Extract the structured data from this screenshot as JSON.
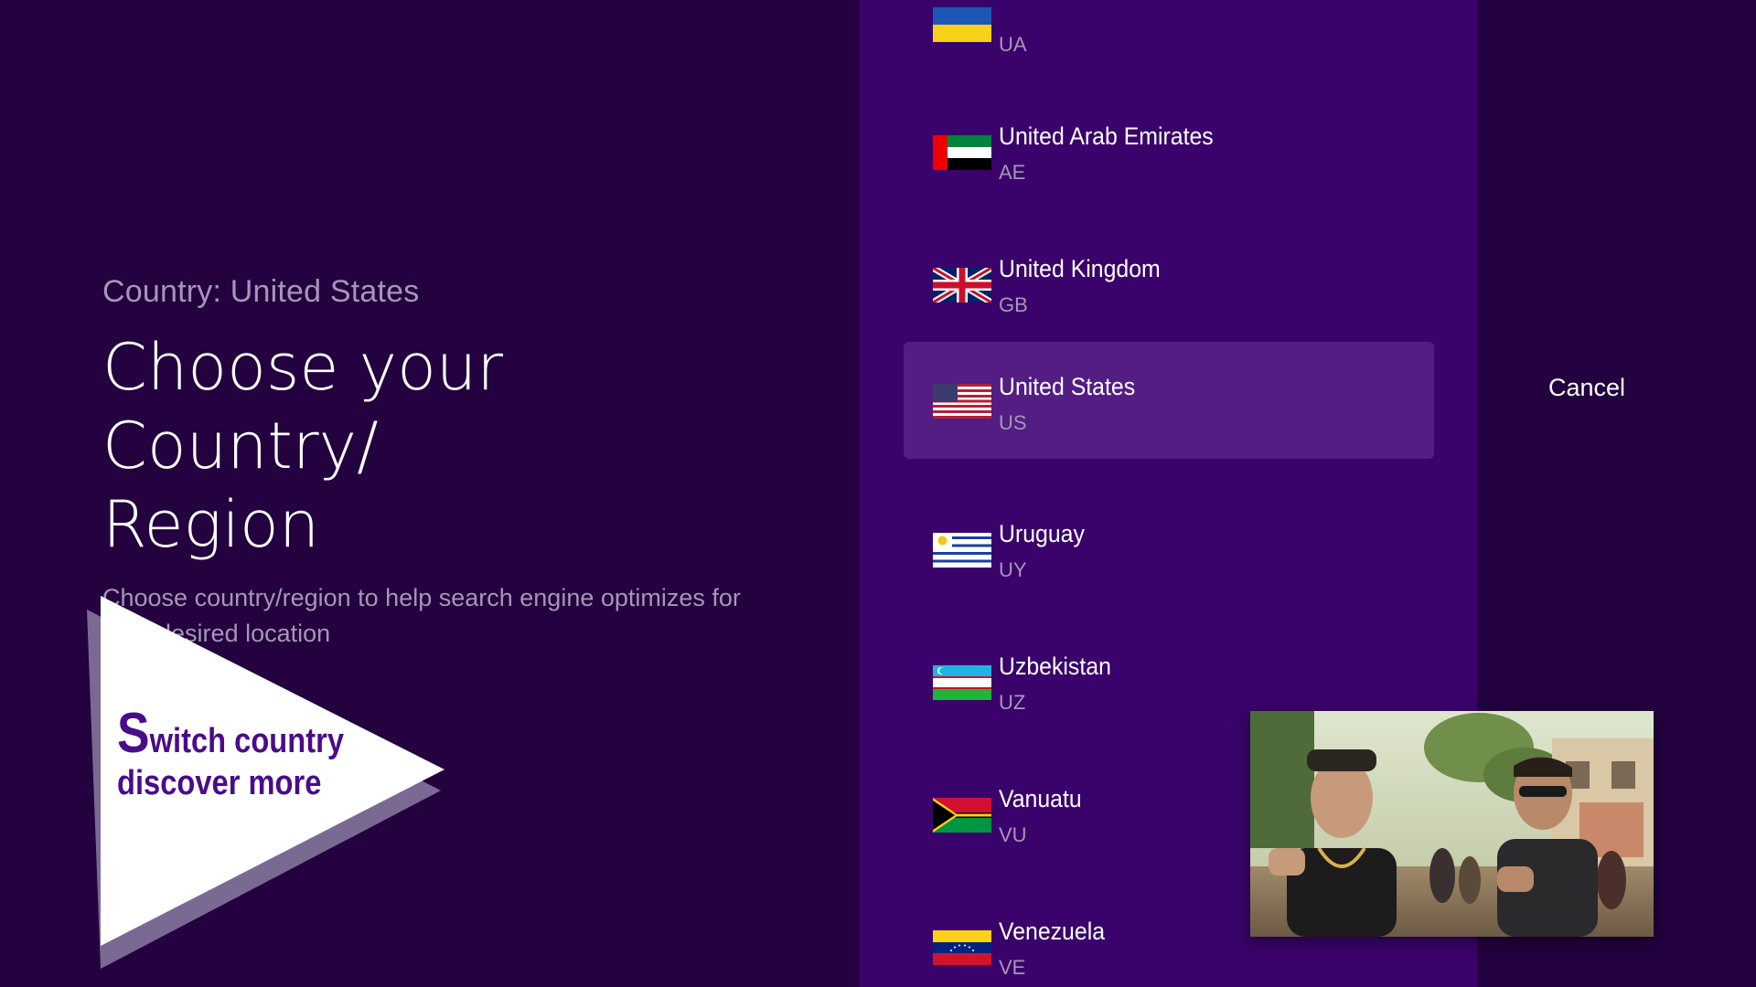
{
  "info": {
    "current_country": "Country: United States",
    "title_line1": "Choose your Country/",
    "title_line2": "Region",
    "subtitle": "Choose country/region to help search engine optimizes for your desired location"
  },
  "promo": {
    "line1_cap": "S",
    "line1_rest": "witch country",
    "line2": "discover more",
    "icon": "play-triangle-icon"
  },
  "countries": [
    {
      "name": "",
      "code": "UA",
      "flag": "flag-ua-icon",
      "selected": false
    },
    {
      "name": "United Arab Emirates",
      "code": "AE",
      "flag": "flag-ae-icon",
      "selected": false
    },
    {
      "name": "United Kingdom",
      "code": "GB",
      "flag": "flag-gb-icon",
      "selected": false
    },
    {
      "name": "United States",
      "code": "US",
      "flag": "flag-us-icon",
      "selected": true
    },
    {
      "name": "Uruguay",
      "code": "UY",
      "flag": "flag-uy-icon",
      "selected": false
    },
    {
      "name": "Uzbekistan",
      "code": "UZ",
      "flag": "flag-uz-icon",
      "selected": false
    },
    {
      "name": "Vanuatu",
      "code": "VU",
      "flag": "flag-vu-icon",
      "selected": false
    },
    {
      "name": "Venezuela",
      "code": "VE",
      "flag": "flag-ve-icon",
      "selected": false
    }
  ],
  "cancel_label": "Cancel",
  "colors": {
    "background": "#23023f",
    "list_panel": "#3a036b",
    "selected_row": "#531d83",
    "muted_text": "#a596b8",
    "promo_text": "#4a0c8a"
  }
}
